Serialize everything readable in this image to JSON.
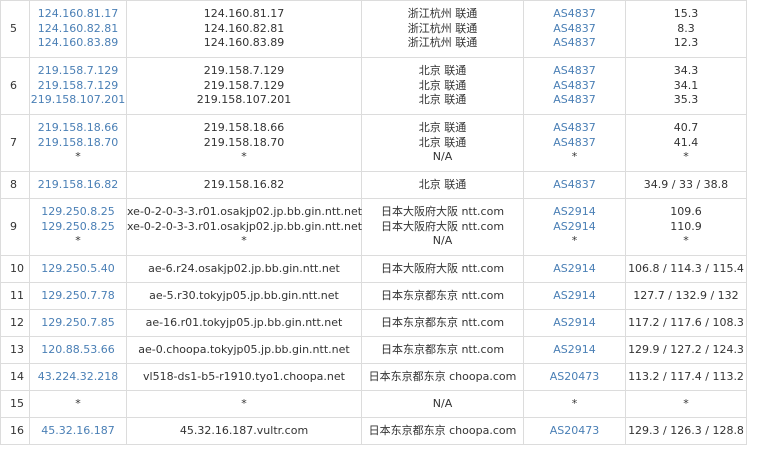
{
  "rows": [
    {
      "hop": "5",
      "ips": [
        "124.160.81.17",
        "124.160.82.81",
        "124.160.83.89"
      ],
      "hosts": [
        "124.160.81.17",
        "124.160.82.81",
        "124.160.83.89"
      ],
      "locs": [
        "浙江杭州 联通",
        "浙江杭州 联通",
        "浙江杭州 联通"
      ],
      "asns": [
        "AS4837",
        "AS4837",
        "AS4837"
      ],
      "times": [
        "15.3",
        "8.3",
        "12.3"
      ]
    },
    {
      "hop": "6",
      "ips": [
        "219.158.7.129",
        "219.158.7.129",
        "219.158.107.201"
      ],
      "hosts": [
        "219.158.7.129",
        "219.158.7.129",
        "219.158.107.201"
      ],
      "locs": [
        "北京 联通",
        "北京 联通",
        "北京 联通"
      ],
      "asns": [
        "AS4837",
        "AS4837",
        "AS4837"
      ],
      "times": [
        "34.3",
        "34.1",
        "35.3"
      ]
    },
    {
      "hop": "7",
      "ips": [
        "219.158.18.66",
        "219.158.18.70",
        "*"
      ],
      "hosts": [
        "219.158.18.66",
        "219.158.18.70",
        "*"
      ],
      "locs": [
        "北京 联通",
        "北京 联通",
        "N/A"
      ],
      "asns": [
        "AS4837",
        "AS4837",
        "*"
      ],
      "times": [
        "40.7",
        "41.4",
        "*"
      ]
    },
    {
      "hop": "8",
      "ips": [
        "219.158.16.82"
      ],
      "hosts": [
        "219.158.16.82"
      ],
      "locs": [
        "北京 联通"
      ],
      "asns": [
        "AS4837"
      ],
      "times": [
        "34.9 / 33 / 38.8"
      ]
    },
    {
      "hop": "9",
      "ips": [
        "129.250.8.25",
        "129.250.8.25",
        "*"
      ],
      "hosts": [
        "xe-0-2-0-3-3.r01.osakjp02.jp.bb.gin.ntt.net",
        "xe-0-2-0-3-3.r01.osakjp02.jp.bb.gin.ntt.net",
        "*"
      ],
      "locs": [
        "日本大阪府大阪 ntt.com",
        "日本大阪府大阪 ntt.com",
        "N/A"
      ],
      "asns": [
        "AS2914",
        "AS2914",
        "*"
      ],
      "times": [
        "109.6",
        "110.9",
        "*"
      ]
    },
    {
      "hop": "10",
      "ips": [
        "129.250.5.40"
      ],
      "hosts": [
        "ae-6.r24.osakjp02.jp.bb.gin.ntt.net"
      ],
      "locs": [
        "日本大阪府大阪 ntt.com"
      ],
      "asns": [
        "AS2914"
      ],
      "times": [
        "106.8 / 114.3 / 115.4"
      ]
    },
    {
      "hop": "11",
      "ips": [
        "129.250.7.78"
      ],
      "hosts": [
        "ae-5.r30.tokyjp05.jp.bb.gin.ntt.net"
      ],
      "locs": [
        "日本东京都东京 ntt.com"
      ],
      "asns": [
        "AS2914"
      ],
      "times": [
        "127.7 / 132.9 / 132"
      ]
    },
    {
      "hop": "12",
      "ips": [
        "129.250.7.85"
      ],
      "hosts": [
        "ae-16.r01.tokyjp05.jp.bb.gin.ntt.net"
      ],
      "locs": [
        "日本东京都东京 ntt.com"
      ],
      "asns": [
        "AS2914"
      ],
      "times": [
        "117.2 / 117.6 / 108.3"
      ]
    },
    {
      "hop": "13",
      "ips": [
        "120.88.53.66"
      ],
      "hosts": [
        "ae-0.choopa.tokyjp05.jp.bb.gin.ntt.net"
      ],
      "locs": [
        "日本东京都东京 ntt.com"
      ],
      "asns": [
        "AS2914"
      ],
      "times": [
        "129.9 / 127.2 / 124.3"
      ]
    },
    {
      "hop": "14",
      "ips": [
        "43.224.32.218"
      ],
      "hosts": [
        "vl518-ds1-b5-r1910.tyo1.choopa.net"
      ],
      "locs": [
        "日本东京都东京 choopa.com"
      ],
      "asns": [
        "AS20473"
      ],
      "times": [
        "113.2 / 117.4 / 113.2"
      ]
    },
    {
      "hop": "15",
      "ips": [
        "*"
      ],
      "hosts": [
        "*"
      ],
      "locs": [
        "N/A"
      ],
      "asns": [
        "*"
      ],
      "times": [
        "*"
      ]
    },
    {
      "hop": "16",
      "ips": [
        "45.32.16.187"
      ],
      "hosts": [
        "45.32.16.187.vultr.com"
      ],
      "locs": [
        "日本东京都东京 choopa.com"
      ],
      "asns": [
        "AS20473"
      ],
      "times": [
        "129.3 / 126.3 / 128.8"
      ]
    }
  ],
  "colors": {
    "link": "#4a7fb5",
    "text": "#333333",
    "border": "#dcdcdc"
  }
}
